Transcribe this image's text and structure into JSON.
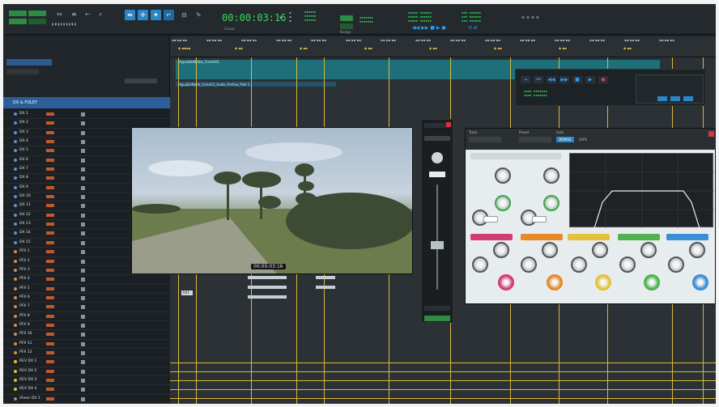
{
  "toolbar": {
    "timecode": "00:00:03:16",
    "timecode_arrow": "▾",
    "nudge_label": "Nudge",
    "cursor_label": "Cursor"
  },
  "timeline": {
    "clip_top_name": "AguaDeNoite_Corte01",
    "clip_second_name": "AguaDeNoite_Corte01_Audio_Prefixo_Pilot 1",
    "clip_small_label": "R01"
  },
  "tracks": {
    "folder": "DX & FOLEY",
    "dx": [
      "DX 1",
      "DX 2",
      "DX 3",
      "DX 4",
      "DX 5",
      "DX 6",
      "DX 7",
      "DX 8",
      "DX 9",
      "DX 10",
      "DX 11",
      "DX 12",
      "DX 13",
      "DX 14",
      "DX 15"
    ],
    "pfx": [
      "PFX 1",
      "PFX 2",
      "PFX 3",
      "PFX 4",
      "PFX 5",
      "PFX 6",
      "PFX 7",
      "PFX 8",
      "PFX 9",
      "PFX 10",
      "PFX 11",
      "PFX 12"
    ],
    "rev": [
      "REV DX 1",
      "REV DX 2",
      "REV DX 3",
      "REV DX 4"
    ],
    "last": "Vheer DX  3"
  },
  "video": {
    "timecode": "00:00:03:16"
  },
  "plugin": {
    "track_label": "Track",
    "preset_label": "Preset",
    "auto_label": "Auto",
    "bypass_label": "BYPASS",
    "safe_label": "SAFE"
  },
  "colors": {
    "accent_green": "#39d95c",
    "accent_blue": "#2a86c8",
    "marker_yellow": "#d8b93c",
    "clip_teal": "#1f6f7a"
  }
}
